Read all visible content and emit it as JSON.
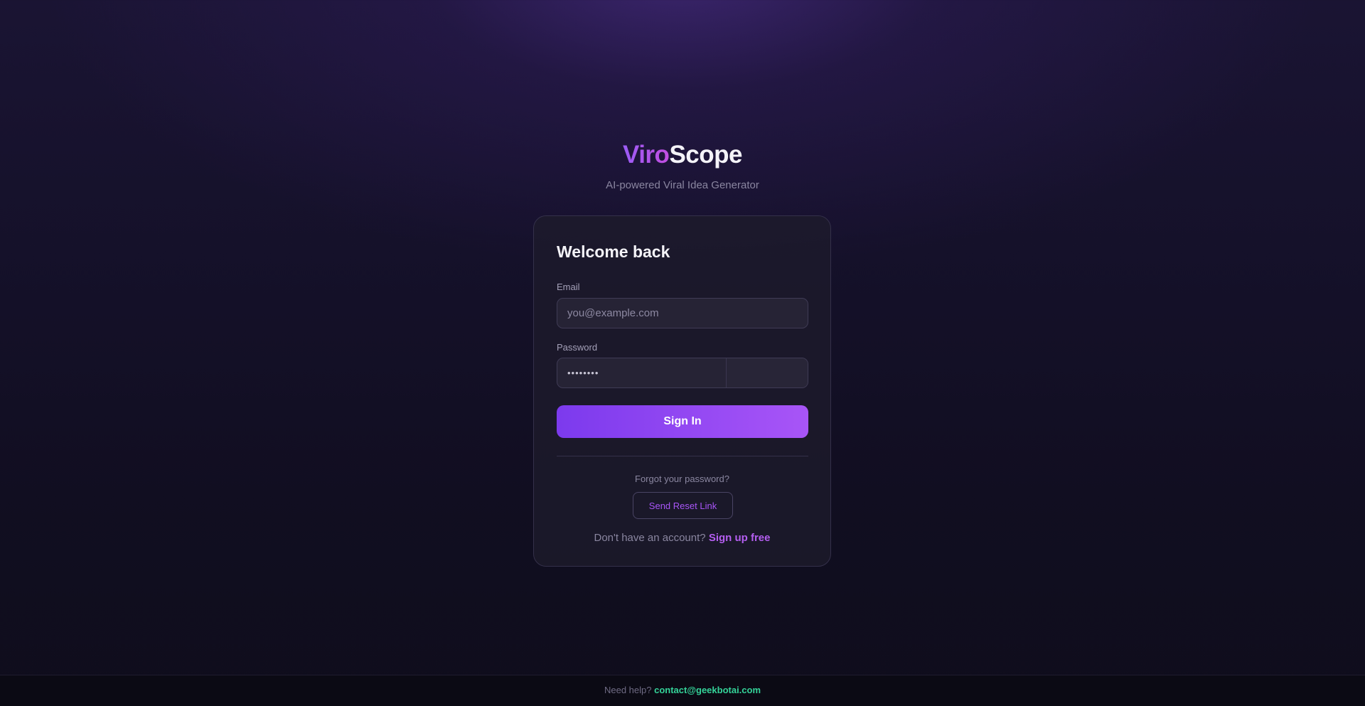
{
  "brand": {
    "name_part1": "Viro",
    "name_part2": "Scope",
    "tagline": "AI-powered Viral Idea Generator"
  },
  "login_form": {
    "title": "Welcome back",
    "email_label": "Email",
    "email_placeholder": "you@example.com",
    "email_value": "",
    "password_label": "Password",
    "password_value_masked": "••••••••",
    "signin_label": "Sign In",
    "forgot_text": "Forgot your password?",
    "reset_label": "Send Reset Link",
    "signup_prompt": "Don't have an account?",
    "signup_link": "Sign up free"
  },
  "footer": {
    "help_text": "Need help?",
    "email": "contact@geekbotai.com"
  },
  "colors": {
    "accent_start": "#7c3aed",
    "accent_end": "#a855f7",
    "link": "#b45ef0",
    "footer_email": "#34d399",
    "background": "#13101f"
  }
}
